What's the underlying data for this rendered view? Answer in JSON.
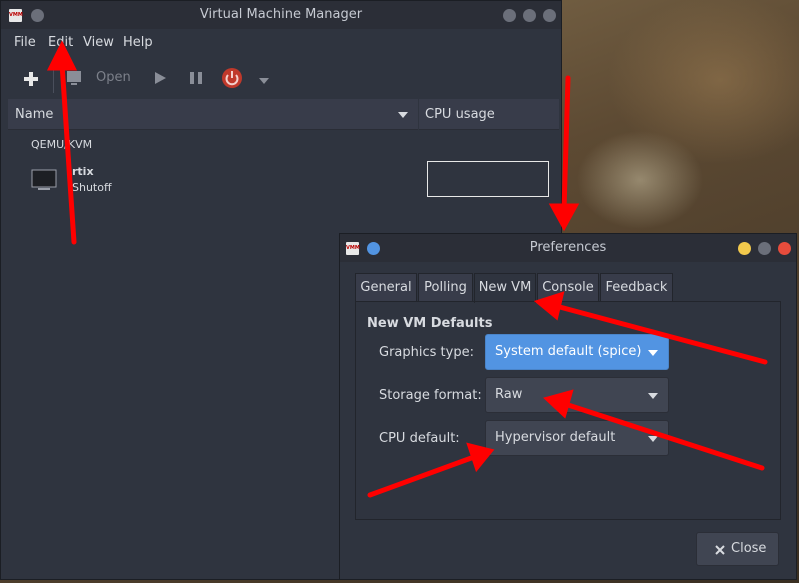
{
  "main_window": {
    "title": "Virtual Machine Manager",
    "app_icon_text": "VMM",
    "menu": [
      "File",
      "Edit",
      "View",
      "Help"
    ],
    "toolbar": {
      "open_label": "Open"
    },
    "columns": {
      "name": "Name",
      "cpu": "CPU usage"
    },
    "connection": "QEMU/KVM",
    "vm": {
      "name": "rtix",
      "state": "Shutoff"
    }
  },
  "prefs_window": {
    "title": "Preferences",
    "app_icon_text": "VMM",
    "tabs": [
      "General",
      "Polling",
      "New VM",
      "Console",
      "Feedback"
    ],
    "active_tab": "New VM",
    "section_title": "New VM Defaults",
    "rows": [
      {
        "label": "Graphics type:",
        "value": "System default (spice)"
      },
      {
        "label": "Storage format:",
        "value": "Raw"
      },
      {
        "label": "CPU default:",
        "value": "Hypervisor default"
      }
    ],
    "close_label": "Close"
  },
  "colors": {
    "accent": "#5294e2",
    "annotation": "#ff0000",
    "power": "#c0392b"
  }
}
